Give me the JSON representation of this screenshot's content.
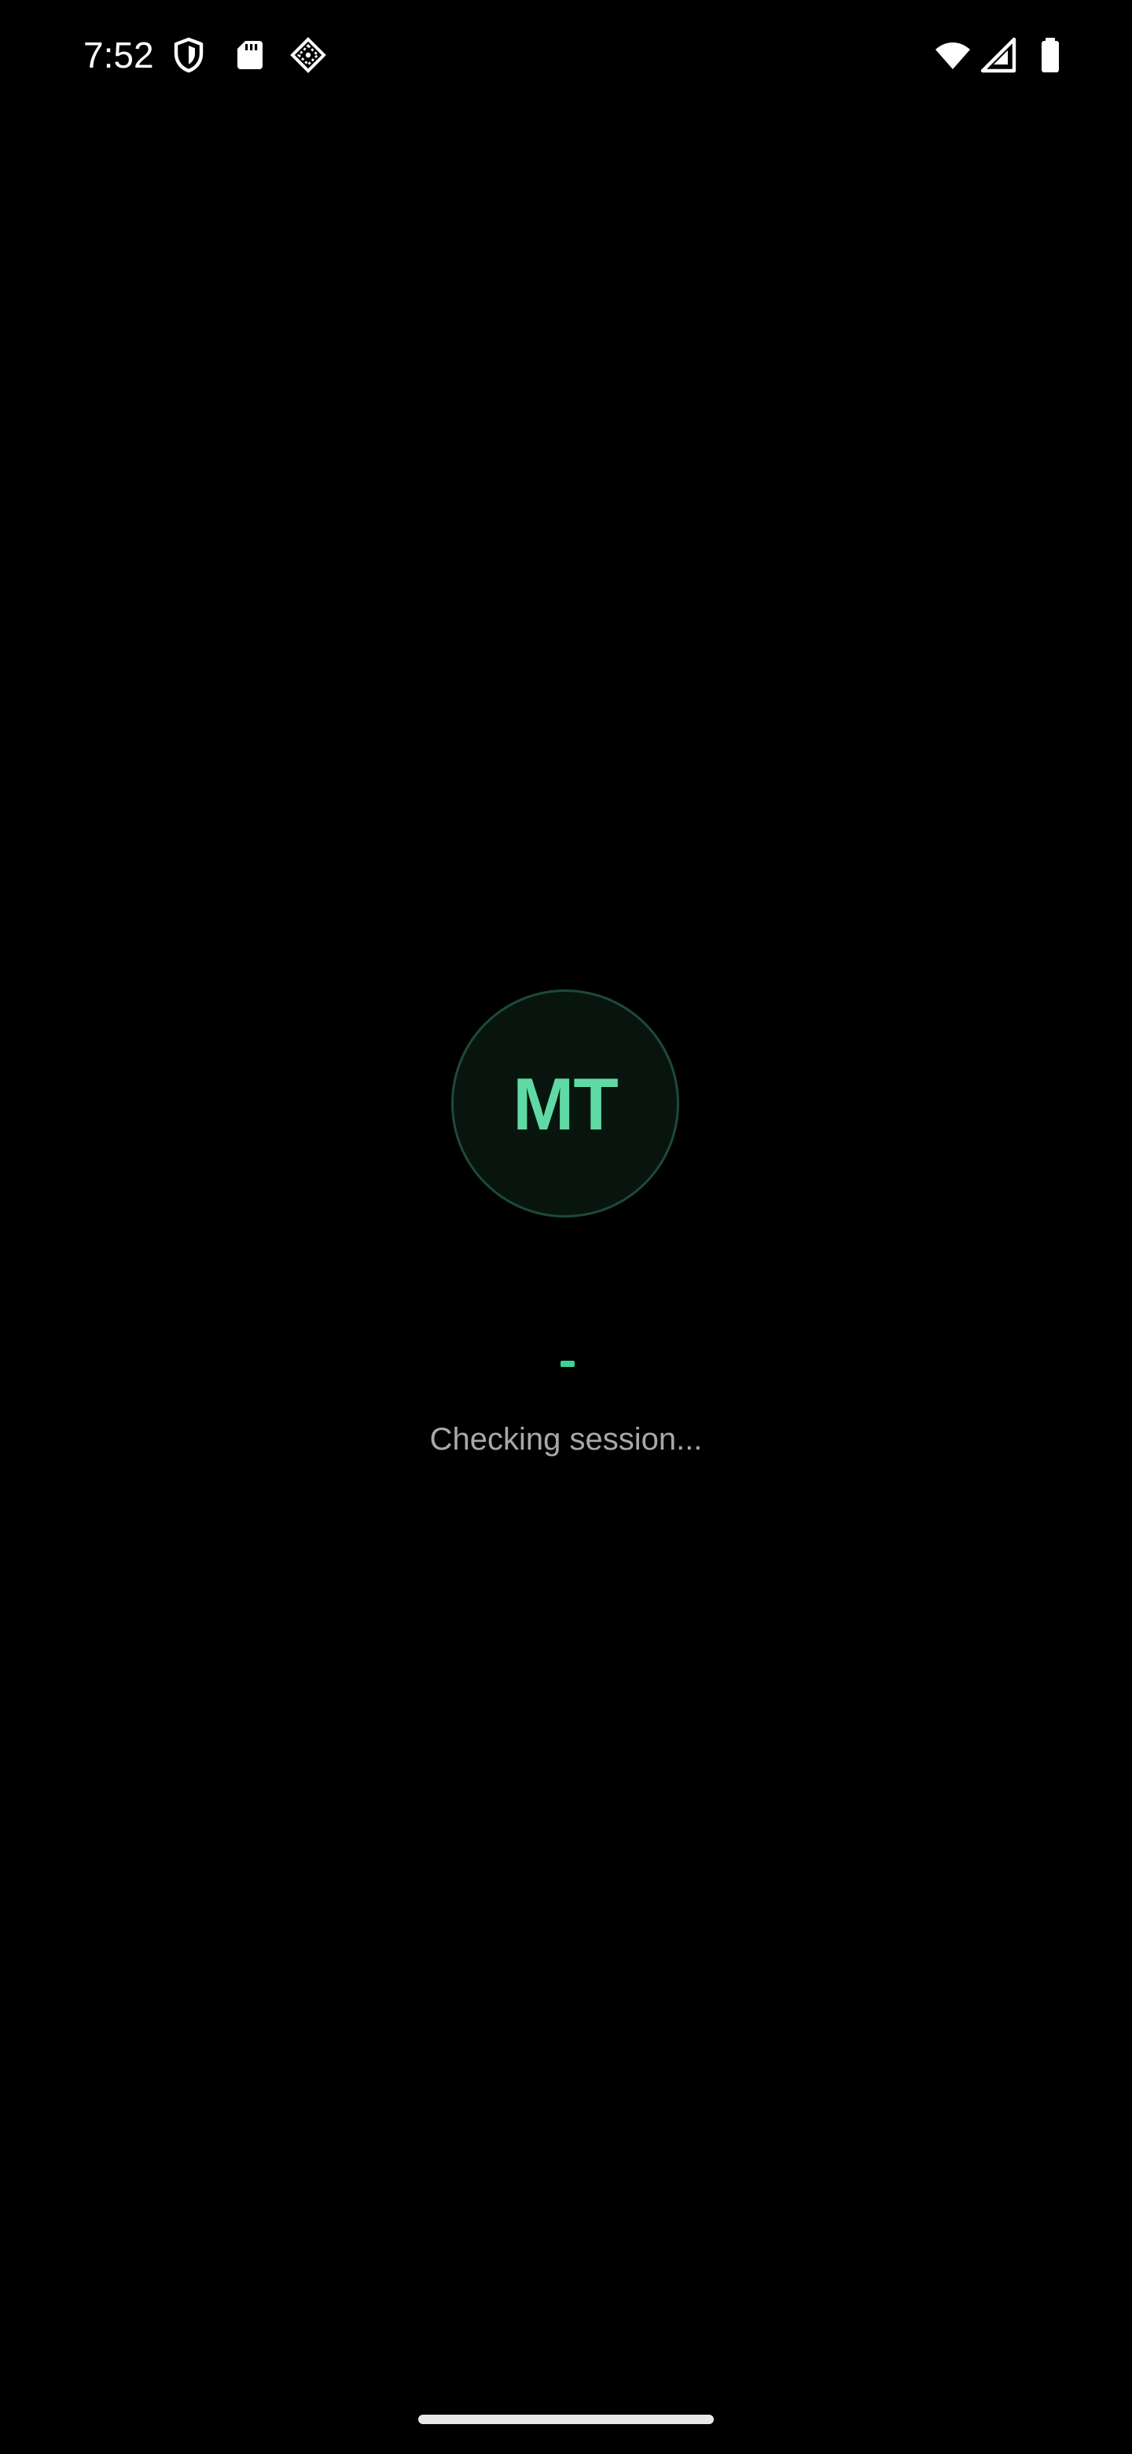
{
  "status_bar": {
    "time": "7:52",
    "left_icons": [
      "shield-icon",
      "sd-card-icon",
      "diamond-grid-icon"
    ],
    "right_icons": [
      "wifi-icon",
      "cell-signal-icon",
      "battery-icon"
    ]
  },
  "splash": {
    "logo_initials": "MT",
    "loading_message": "Checking session..."
  },
  "colors": {
    "background": "#000000",
    "accent": "#5fdaa5",
    "progress": "#39d39a",
    "logo_fill": "#08150f",
    "logo_border": "#1d4a38",
    "message_text": "#a8a8a8"
  }
}
